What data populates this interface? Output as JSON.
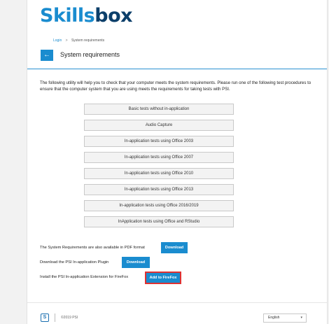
{
  "brand": {
    "part1": "Skills",
    "part2": "box"
  },
  "breadcrumb": {
    "login": "Login",
    "separator": ">",
    "current": "System requirements"
  },
  "header": {
    "back_icon": "arrow-left-icon",
    "back_glyph": "←",
    "title": "System requirements"
  },
  "intro": "The following utility will help you to check that your computer meets the system requirements. Please run one of the following test procedures to ensure that the computer system that you are using meets the requirements for taking tests with PSI.",
  "tests": [
    "Basic tests without in-application",
    "Audio Capture",
    "In-application tests using Office 2003",
    "In-application tests using Office 2007",
    "In-application tests using Office 2010",
    "In-application tests using Office 2013",
    "In-application tests using Office 2016/2019",
    "InApplication tests using Office and RStudio"
  ],
  "downloads": {
    "pdf_text": "The System Requirements are also available in PDF format",
    "pdf_button": "Download",
    "plugin_text": "Download the PSI In-application Plugin",
    "plugin_button": "Download",
    "extension_text": "Install the PSI In-application Extension for FireFox",
    "extension_button": "Add to FireFox"
  },
  "footer": {
    "logo_letter": "S",
    "copyright": "©2019 PSI",
    "language": "English",
    "chevron_icon": "chevron-down-icon",
    "chevron_glyph": "▾"
  },
  "colors": {
    "accent": "#1a8ccf",
    "brand_dark": "#0c3f6a",
    "highlight": "#e03131"
  }
}
